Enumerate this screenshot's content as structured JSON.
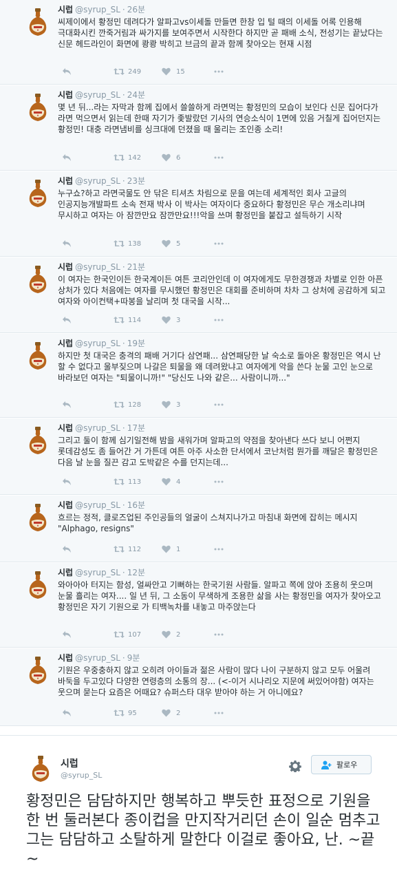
{
  "icons": {
    "reply": "reply-icon",
    "retweet": "retweet-icon",
    "like": "heart-icon",
    "more": "more-icon",
    "settings": "gear-icon",
    "follow": "add-user-icon"
  },
  "tweets": [
    {
      "name": "시럽",
      "handle": "@syrup_SL",
      "dot": "·",
      "time": "26분",
      "text": "씨제이에서 황정민 데려다가 알파고vs이세돌 만들면 한창 입 털 때의 이세돌 어록 인용해 극대화시킨 깐죽거림과 싸가지를 보여주면서 시작한다 하지만 곧 패배 소식, 전성기는 끝났다는 신문 헤드라인이 화면에 쾅쾅 박히고 브금의 끝과 함께 찾아오는 현재 시점",
      "retweets": "249",
      "likes": "15"
    },
    {
      "name": "시럽",
      "handle": "@syrup_SL",
      "dot": "·",
      "time": "24분",
      "text": "몇 년 뒤...라는 자막과 함께 집에서 쓸쓸하게 라면먹는 황정민의 모습이 보인다 신문 집어다가 라면 먹으면서 읽는데 한때 자기가 좇발랐던 기사의 연승소식이 1면에 있음 거칠게 집어던지는 황정민! 대충 라면냄비를 싱크대에 던졌을 때 울리는 조인종 소리!",
      "retweets": "142",
      "likes": "6"
    },
    {
      "name": "시럽",
      "handle": "@syrup_SL",
      "dot": "·",
      "time": "23분",
      "text": "누구쇼?하고 라면국물도 안 닦은 티셔츠 차림으로 문을 여는데 세계적인 회사 고글의 인공지능개발파트 소속 전재 박사 이 박사는 여자이다 중요하다 황정민은 무슨 개소리냐며 무시하고 여자는 아 잠깐만요 잠깐만요!!!악을 쓰며 황정민을 붙잡고 설득하기 시작",
      "retweets": "138",
      "likes": "5"
    },
    {
      "name": "시럽",
      "handle": "@syrup_SL",
      "dot": "·",
      "time": "21분",
      "text": "이 여자는 한국인이든 한국계이든 여튼 코리안인데 이 여자에게도 무한경쟁과 차별로 인한 아픈 상처가 있다 처음에는 여자를 무시했던 황정민은 대회를 준비하며 차차 그 상처에 공감하게 되고 여자와 아이컨택+따봉을 날리며 첫 대국을 시작...",
      "retweets": "114",
      "likes": "3"
    },
    {
      "name": "시럽",
      "handle": "@syrup_SL",
      "dot": "·",
      "time": "19분",
      "text": "하지만 첫 대국은 충격의 패배 거기다 삼연패... 삼연패당한 날 숙소로 돌아온 황정민은 역시 난 할 수 없다고 울부짖으며 나갈은 퇴물을 왜 데려왔냐고 여자에게 악을 쓴다 눈물 고인 눈으로 바라보던 여자는 \"퇴물이니까!\" \"당신도 나와 같은... 사람이니까...\"",
      "retweets": "128",
      "likes": "3"
    },
    {
      "name": "시럽",
      "handle": "@syrup_SL",
      "dot": "·",
      "time": "17분",
      "text": "그리고 둘이 함께 심기일전해 밤을 새워가며 알파고의 약점을 찾아낸다 쓰다 보니 어쩐지 롯데감성도 좀 들어간 거 가튼데 여튼 아주 사소한 단서에서 코난처럼 뭔가를 깨달은 황정민은 다음 날 눈을 질끈 감고 도박같은 수를 던지는데...",
      "retweets": "113",
      "likes": "4"
    },
    {
      "name": "시럽",
      "handle": "@syrup_SL",
      "dot": "·",
      "time": "16분",
      "text": "흐르는 정적, 클로즈업된 주인공들의 얼굴이 스쳐지나가고 마침내 화면에 잡히는 메시지 \"Alphago, resigns\"",
      "retweets": "112",
      "likes": "1"
    },
    {
      "name": "시럽",
      "handle": "@syrup_SL",
      "dot": "·",
      "time": "12분",
      "text": "와아아아 터지는 함성, 얼싸안고 기뻐하는 한국기원 사람들. 알파고 쪽에 앉아 조용히 웃으며 눈물 흘리는 여자.... 일 년 뒤, 그 소동이 무색하게 조용한 삶을 사는 황정민을 여자가 찾아오고 황정민은 자기 기원으로 가 티백녹차를 내놓고 마주앉는다",
      "retweets": "107",
      "likes": "2"
    },
    {
      "name": "시럽",
      "handle": "@syrup_SL",
      "dot": "·",
      "time": "9분",
      "text": "기원은 우중충하지 않고 오히려 아이들과 젊은 사람이 많다 나이 구분하지 않고 모두 어울려 바둑을 두고있다 다양한 연령층의 소통의 장... (<-이거 시나리오 지문에 써있어야함) 여자는 웃으며 묻는다 요즘은 어때요? 슈퍼스타 대우 받아야 하는 거 아니에요?",
      "retweets": "95",
      "likes": "2"
    }
  ],
  "main_tweet": {
    "name": "시럽",
    "handle": "@syrup_SL",
    "follow_label": "팔로우",
    "text": "황정민은 담담하지만 행복하고 뿌듯한 표정으로 기원을 한 번 둘러본다 종이컵을 만지작거리던 손이 일순 멈추고 그는 담담하고 소탈하게 말한다 이걸로 좋아요, 난. ~끝~"
  }
}
